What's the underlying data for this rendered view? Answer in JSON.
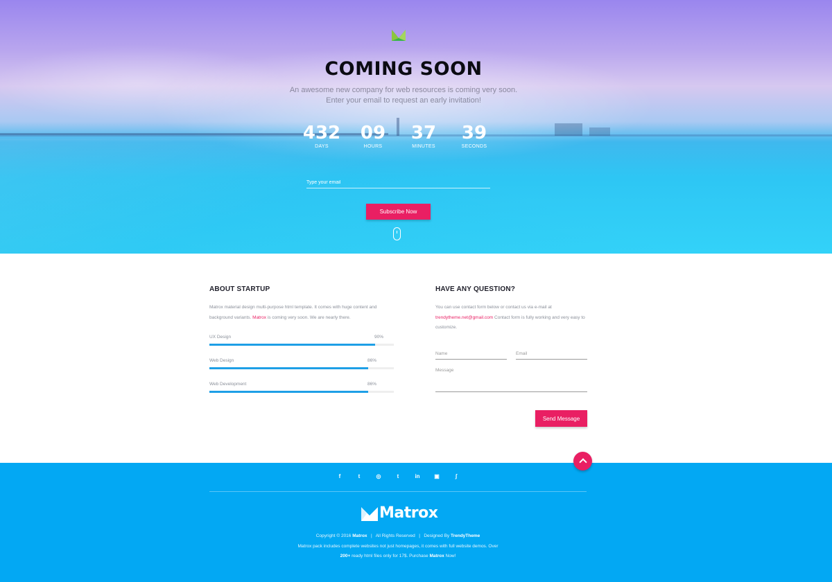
{
  "hero": {
    "title": "COMING SOON",
    "subtitle_line1": "An awesome new company for web resources is coming very soon.",
    "subtitle_line2": "Enter your email to request an early invitation!",
    "countdown": [
      {
        "value": "432",
        "label": "DAYS"
      },
      {
        "value": "09",
        "label": "HOURS"
      },
      {
        "value": "37",
        "label": "MINUTES"
      },
      {
        "value": "39",
        "label": "SECONDS"
      }
    ],
    "email_placeholder": "Type your email",
    "subscribe_label": "Subscribe Now",
    "colors": {
      "accent": "#e91f63"
    }
  },
  "about": {
    "title": "ABOUT STARTUP",
    "text_pre": "Matrox material design multi-purpose html template. It comes with huge content and background variants. ",
    "text_brand": "Matrox",
    "text_post": " is coming very soon. We are nearly there.",
    "skills": [
      {
        "label": "UX Design",
        "percent_text": "90%",
        "value": 0.9
      },
      {
        "label": "Web Design",
        "percent_text": "86%",
        "value": 0.86
      },
      {
        "label": "Web Development",
        "percent_text": "86%",
        "value": 0.86
      }
    ],
    "colors": {
      "bar": "#1e9fe6",
      "track": "#eeeeee"
    }
  },
  "contact": {
    "title": "HAVE ANY QUESTION?",
    "text_pre": "You can use contact form below or contact us via e-mail at ",
    "email": "trendytheme.net@gmail.com",
    "text_post": " Contact form is fully working and very easy to customize.",
    "name_placeholder": "Name",
    "email_placeholder": "Email",
    "message_placeholder": "Message",
    "send_label": "Send Message"
  },
  "footer": {
    "social_icons": [
      "facebook-icon",
      "twitter-icon",
      "dribbble-icon",
      "tumblr-icon",
      "linkedin-icon",
      "instagram-icon",
      "rss-icon"
    ],
    "social_glyphs": [
      "f",
      "t",
      "◎",
      "t",
      "in",
      "▣",
      "ʃ"
    ],
    "logo_text": "Matrox",
    "copyright_pre": "Copyright © 2016 ",
    "copyright_brand": "Matrox",
    "copyright_mid": "   |   All Rights Reserved   |   Designed By ",
    "copyright_designer": "TrendyTheme",
    "pack_line1": "Matrox pack includes complete websites not just homepages, it comes with full website demos. Over",
    "pack_count": "200+",
    "pack_mid": " ready html files only for 17$. Purchase ",
    "pack_brand": "Matrox",
    "pack_end": " Now!",
    "colors": {
      "background": "#03a8f3"
    }
  }
}
